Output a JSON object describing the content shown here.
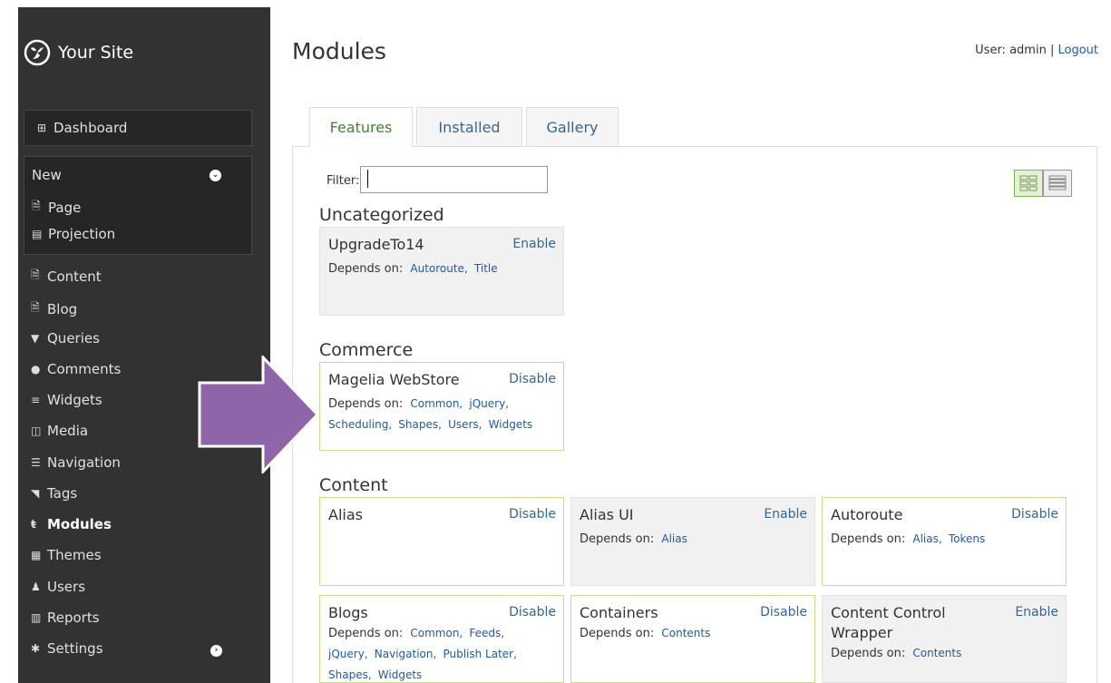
{
  "sidebar": {
    "brand": "Your Site",
    "dashboard": "Dashboard",
    "new_section": {
      "label": "New",
      "items": [
        "Page",
        "Projection"
      ]
    },
    "items": [
      "Content",
      "Blog",
      "Queries",
      "Comments",
      "Widgets",
      "Media",
      "Navigation",
      "Tags",
      "Modules",
      "Themes",
      "Users",
      "Reports",
      "Settings"
    ]
  },
  "header": {
    "title": "Modules",
    "user_text": "User: admin",
    "separator": "|",
    "logout": "Logout"
  },
  "tabs": [
    "Features",
    "Installed",
    "Gallery"
  ],
  "filter": {
    "label": "Filter:",
    "value": ""
  },
  "depends_label": "Depends on:",
  "sections": [
    {
      "title": "Uncategorized"
    },
    {
      "title": "Commerce"
    },
    {
      "title": "Content"
    }
  ],
  "modules": [
    {
      "name": "UpgradeTo14",
      "action": "Enable",
      "deps": [
        "Autoroute,",
        "Title"
      ]
    },
    {
      "name": "Magelia WebStore",
      "action": "Disable",
      "deps": [
        "Common,",
        "jQuery,",
        "Scheduling,",
        "Shapes,",
        "Users,",
        "Widgets"
      ]
    },
    {
      "name": "Alias",
      "action": "Disable",
      "deps": []
    },
    {
      "name": "Alias UI",
      "action": "Enable",
      "deps": [
        "Alias"
      ]
    },
    {
      "name": "Autoroute",
      "action": "Disable",
      "deps": [
        "Alias,",
        "Tokens"
      ]
    },
    {
      "name": "Blogs",
      "action": "Disable",
      "deps": [
        "Common,",
        "Feeds,",
        "jQuery,",
        "Navigation,",
        "Publish Later,",
        "Shapes,",
        "Widgets"
      ]
    },
    {
      "name": "Containers",
      "action": "Disable",
      "deps": [
        "Contents"
      ]
    },
    {
      "name": "Content Control Wrapper",
      "action": "Enable",
      "deps": [
        "Contents"
      ]
    }
  ],
  "colors": {
    "sidebar_bg": "#323232",
    "link": "#336699",
    "active_tab": "#3d8a2a",
    "enabled_border": "#c8de8a",
    "arrow": "#8e65a8"
  }
}
